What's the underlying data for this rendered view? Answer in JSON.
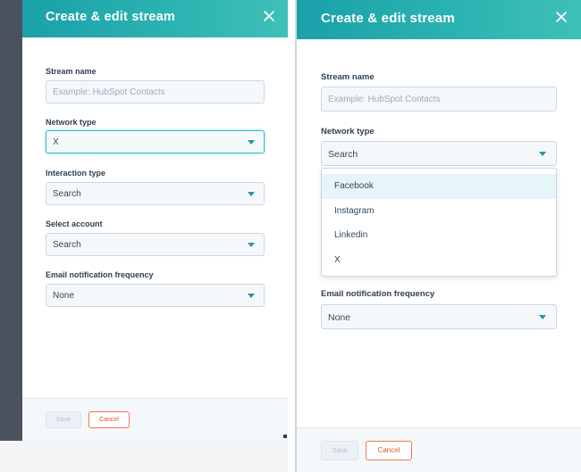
{
  "left": {
    "title": "Create & edit stream",
    "stream_name": {
      "label": "Stream name",
      "placeholder": "Example: HubSpot Contacts"
    },
    "network_type": {
      "label": "Network type",
      "value": "X"
    },
    "interaction_type": {
      "label": "Interaction type",
      "value": "Search"
    },
    "select_account": {
      "label": "Select account",
      "value": "Search"
    },
    "email_frequency": {
      "label": "Email notification frequency",
      "value": "None"
    },
    "save_label": "Save",
    "cancel_label": "Cancel"
  },
  "right": {
    "title": "Create & edit stream",
    "stream_name": {
      "label": "Stream name",
      "placeholder": "Example: HubSpot Contacts"
    },
    "network_type": {
      "label": "Network type",
      "value": "Search"
    },
    "dropdown_options": [
      "Facebook",
      "Instagram",
      "Linkedin",
      "X"
    ],
    "email_frequency": {
      "label": "Email notification frequency",
      "value": "None"
    },
    "save_label": "Save",
    "cancel_label": "Cancel"
  },
  "colors": {
    "header_teal": "#2cb4b2",
    "caret": "#1b9aa7",
    "cancel": "#e4542d",
    "focus_border": "#35bfc7"
  },
  "icons": [
    "close-icon",
    "chevron-down-icon"
  ]
}
